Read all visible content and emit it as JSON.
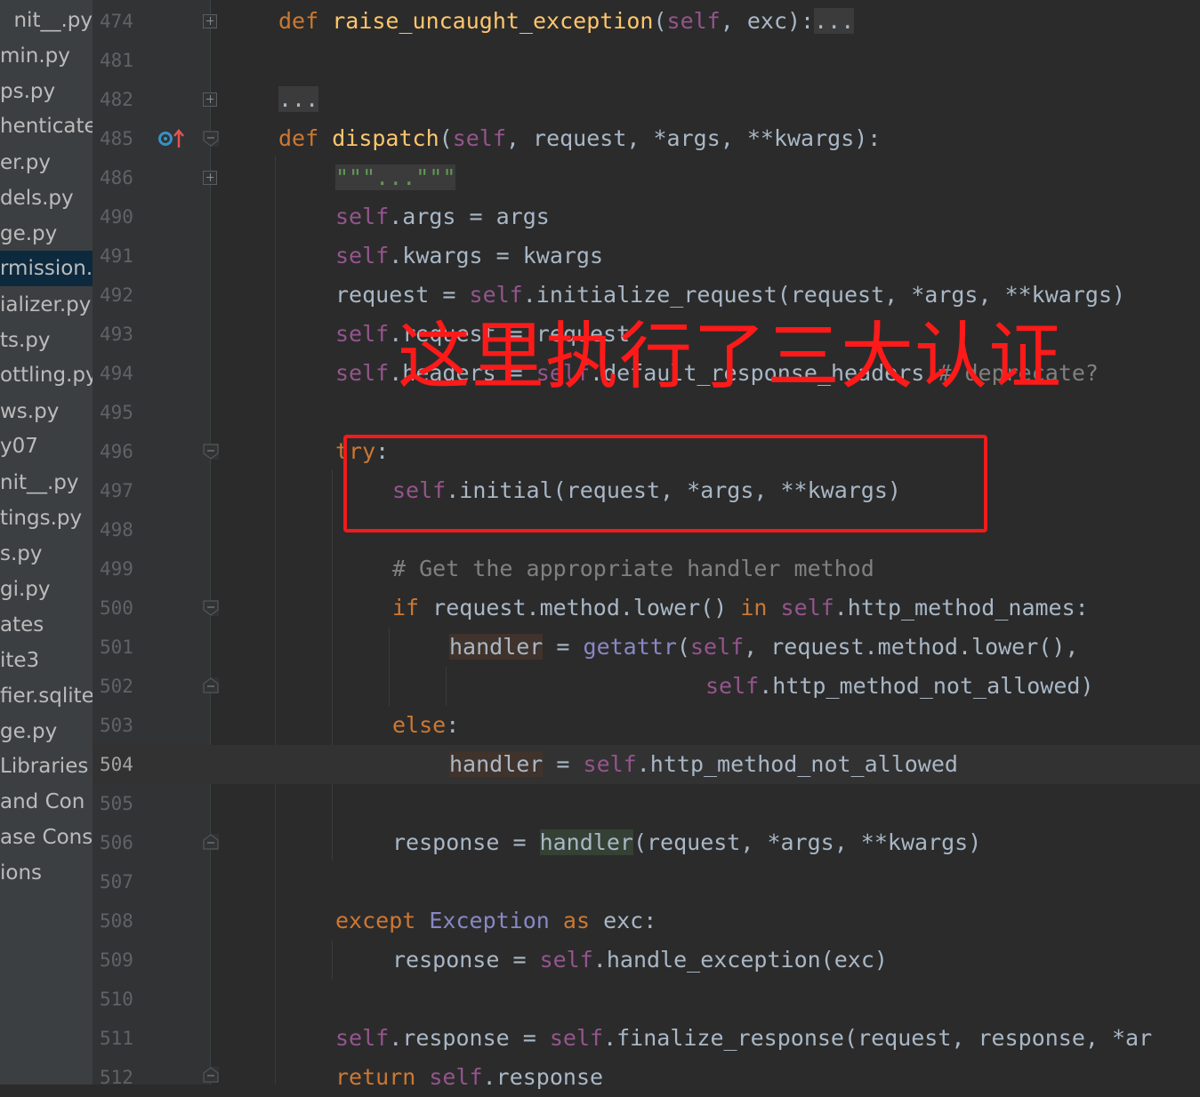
{
  "sidebar": {
    "files": [
      {
        "label": "nit__.py"
      },
      {
        "label": "min.py"
      },
      {
        "label": "ps.py"
      },
      {
        "label": "henticate"
      },
      {
        "label": "er.py"
      },
      {
        "label": "dels.py"
      },
      {
        "label": "ge.py"
      },
      {
        "label": "rmission.p"
      },
      {
        "label": "ializer.py"
      },
      {
        "label": "ts.py"
      },
      {
        "label": "ottling.py"
      },
      {
        "label": "ws.py"
      },
      {
        "label": "y07"
      },
      {
        "label": "nit__.py"
      },
      {
        "label": "tings.py"
      },
      {
        "label": "s.py"
      },
      {
        "label": "gi.py"
      },
      {
        "label": "ates"
      },
      {
        "label": "ite3"
      },
      {
        "label": "fier.sqlite"
      },
      {
        "label": "ge.py"
      },
      {
        "label": "Libraries"
      },
      {
        "label": " and Con"
      },
      {
        "label": "ase Consc"
      },
      {
        "label": "ions"
      }
    ],
    "selected_index": 7
  },
  "gutter": {
    "line_numbers": [
      "474",
      "481",
      "482",
      "485",
      "486",
      "490",
      "491",
      "492",
      "493",
      "494",
      "495",
      "496",
      "497",
      "498",
      "499",
      "500",
      "501",
      "502",
      "503",
      "504",
      "505",
      "506",
      "507",
      "508",
      "509",
      "510",
      "511",
      "512"
    ],
    "current_line": "504"
  },
  "code": {
    "l474": {
      "def": "def",
      "name": "raise_uncaught_exception",
      "p1": "(",
      "self": "self",
      "rest": ", exc):",
      "fold": "..."
    },
    "l482": {
      "fold": "..."
    },
    "l485": {
      "def": "def",
      "name": "dispatch",
      "p1": "(",
      "self": "self",
      "rest": ", request, *args, **kwargs):"
    },
    "l486": {
      "fold": "\"\"\"...\"\"\""
    },
    "l490": {
      "self": "self",
      "rest": ".args = args"
    },
    "l491": {
      "self": "self",
      "rest": ".kwargs = kwargs"
    },
    "l492": {
      "a": "request = ",
      "self": "self",
      "rest": ".initialize_request(request, *args, **kwargs)"
    },
    "l493": {
      "self": "self",
      "rest": ".request = request"
    },
    "l494": {
      "self": "self",
      "a": ".headers = ",
      "self2": "self",
      "rest": ".default_response_headers ",
      "comment": "# deprecate?"
    },
    "l496": {
      "kw": "try",
      "rest": ":"
    },
    "l497": {
      "self": "self",
      "rest": ".initial(request, *args, **kwargs)"
    },
    "l499": {
      "comment": "# Get the appropriate handler method"
    },
    "l500": {
      "kw": "if",
      "a": " request.method.lower() ",
      "kw2": "in",
      "sp": " ",
      "self": "self",
      "rest": ".http_method_names:"
    },
    "l501": {
      "var": "handler",
      "a": " = ",
      "builtin": "getattr",
      "p": "(",
      "self": "self",
      "rest": ", request.method.lower(),"
    },
    "l502": {
      "self": "self",
      "rest": ".http_method_not_allowed)"
    },
    "l503": {
      "kw": "else",
      "rest": ":"
    },
    "l504": {
      "var": "handler",
      "a": " = ",
      "self": "self",
      "rest": ".http_method_not_allowed"
    },
    "l506": {
      "a": "response = ",
      "call": "handler",
      "rest": "(request, *args, **kwargs)"
    },
    "l508": {
      "kw": "except",
      "sp": " ",
      "cls": "Exception",
      "sp2": " ",
      "kw2": "as",
      "rest": " exc:"
    },
    "l509": {
      "a": "response = ",
      "self": "self",
      "rest": ".handle_exception(exc)"
    },
    "l511": {
      "self": "self",
      "a": ".response = ",
      "self2": "self",
      "rest": ".finalize_response(request, response, *ar"
    },
    "l512": {
      "kw": "return",
      "sp": " ",
      "self": "self",
      "rest": ".response"
    }
  },
  "annotation": {
    "text": "这里执行了三大认证"
  },
  "colors": {
    "background": "#2b2b2b",
    "keyword": "#cc7832",
    "function": "#ffc66d",
    "self": "#94558d",
    "comment": "#808080",
    "annotation_red": "#ff1a1a"
  }
}
